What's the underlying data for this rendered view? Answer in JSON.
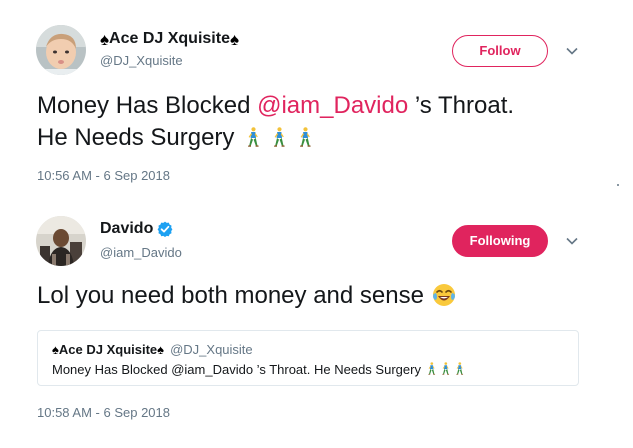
{
  "tweet1": {
    "display_name": "Ace DJ Xquisite",
    "spade_glyph": "♠",
    "handle": "@DJ_Xquisite",
    "follow_label": "Follow",
    "text_before": "Money Has Blocked ",
    "mention": "@iam_Davido",
    "text_after_line1": " ’s Throat.",
    "text_line2": "He Needs Surgery",
    "emoji": "person-walking-icon",
    "timestamp": "10:56 AM - 6 Sep 2018"
  },
  "tweet2": {
    "display_name": "Davido",
    "verified": true,
    "handle": "@iam_Davido",
    "following_label": "Following",
    "text": "Lol you need both money and sense",
    "emoji": "face-with-tears-of-joy-icon",
    "timestamp": "10:58 AM - 6 Sep 2018",
    "quote": {
      "display_name": "Ace DJ Xquisite",
      "handle": "@DJ_Xquisite",
      "text": "Money Has Blocked @iam_Davido ’s Throat. He Needs Surgery"
    }
  },
  "colors": {
    "accent": "#e0245e",
    "verified_blue": "#1da1f2",
    "muted_text": "#657786",
    "border": "#e1e8ed"
  }
}
